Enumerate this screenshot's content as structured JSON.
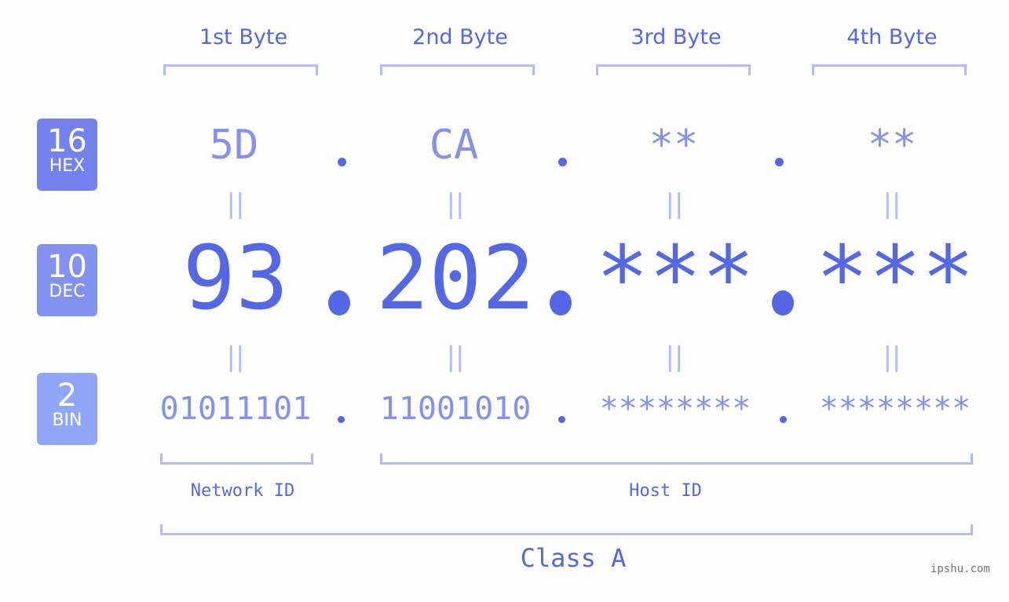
{
  "bytes": [
    {
      "label": "1st Byte",
      "hex": "5D",
      "dec": "93",
      "bin": "01011101"
    },
    {
      "label": "2nd Byte",
      "hex": "CA",
      "dec": "202",
      "bin": "11001010"
    },
    {
      "label": "3rd Byte",
      "hex": "**",
      "dec": "***",
      "bin": "********"
    },
    {
      "label": "4th Byte",
      "hex": "**",
      "dec": "***",
      "bin": "********"
    }
  ],
  "badges": [
    {
      "num": "16",
      "label": "HEX",
      "color": "#7483ec"
    },
    {
      "num": "10",
      "label": "DEC",
      "color": "#8391f1"
    },
    {
      "num": "2",
      "label": "BIN",
      "color": "#90a6f8"
    }
  ],
  "equals_sign": "||",
  "network_id_label": "Network ID",
  "host_id_label": "Host ID",
  "class_label": "Class A",
  "watermark": "ipshu.com"
}
